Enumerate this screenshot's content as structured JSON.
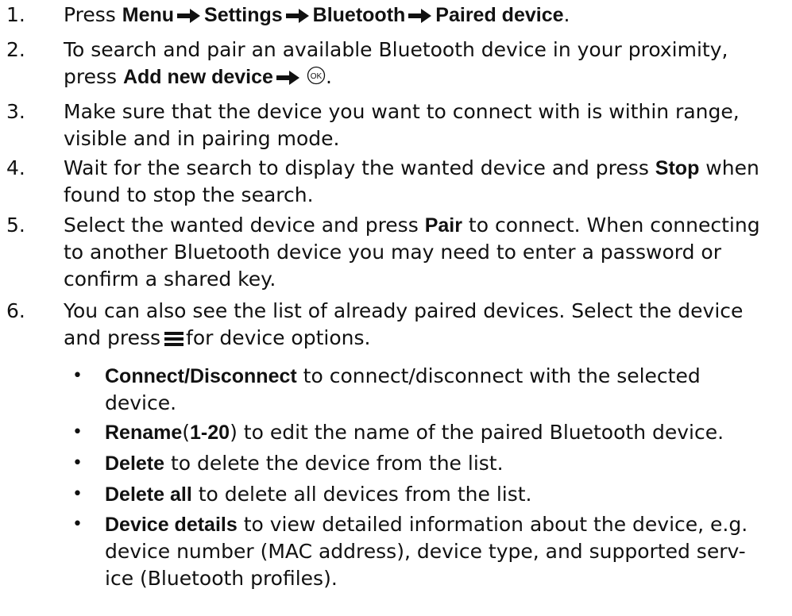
{
  "steps": [
    {
      "number": "1.",
      "parts": [
        "Press",
        "Menu",
        "Settings",
        "Bluetooth",
        "Paired device",
        "."
      ]
    },
    {
      "number": "2.",
      "line1": "To search and pair an available Bluetooth device in your proximity,",
      "press": "press",
      "action": "Add new device",
      "end": "."
    },
    {
      "number": "3.",
      "line1": "Make sure that the device you want to connect with is within range,",
      "line2": "visible and in pairing mode."
    },
    {
      "number": "4.",
      "pre": "Wait for the search to display the wanted device and press",
      "bold": "Stop",
      "post": "when",
      "line2": "found to stop the search."
    },
    {
      "number": "5.",
      "pre": "Select the wanted device and press",
      "bold": "Pair",
      "post": "to connect. When connecting",
      "line2": "to another Bluetooth device you may need to enter a password or",
      "line3": "confirm a shared key."
    },
    {
      "number": "6.",
      "line1": "You can also see the list of already paired devices. Select the device",
      "pre": "and press",
      "post": "for device options."
    }
  ],
  "options": [
    {
      "bullet": "•",
      "bold_a": "Connect",
      "slash": "/",
      "bold_b": "Disconnect",
      "text": "to connect/disconnect with the selected",
      "line2": "device."
    },
    {
      "bullet": "•",
      "bold": "Rename",
      "paren_open": "(",
      "bold_range": "1-20",
      "paren_close": ")",
      "text": "to edit the name of the paired Bluetooth device."
    },
    {
      "bullet": "•",
      "bold": "Delete",
      "text": "to delete the device from the list."
    },
    {
      "bullet": "•",
      "bold": "Delete all",
      "text": "to delete all devices from the list."
    },
    {
      "bullet": "•",
      "bold": "Device details",
      "text": "to view detailed information about the device, e.g.",
      "line2": "device number (MAC address), device type, and supported serv-",
      "line3": "ice (Bluetooth profiles)."
    }
  ],
  "icons": {
    "arrow": "arrow-right-icon",
    "ok": "ok-key-icon",
    "menu": "menu-key-icon"
  },
  "ok_label": "OK"
}
